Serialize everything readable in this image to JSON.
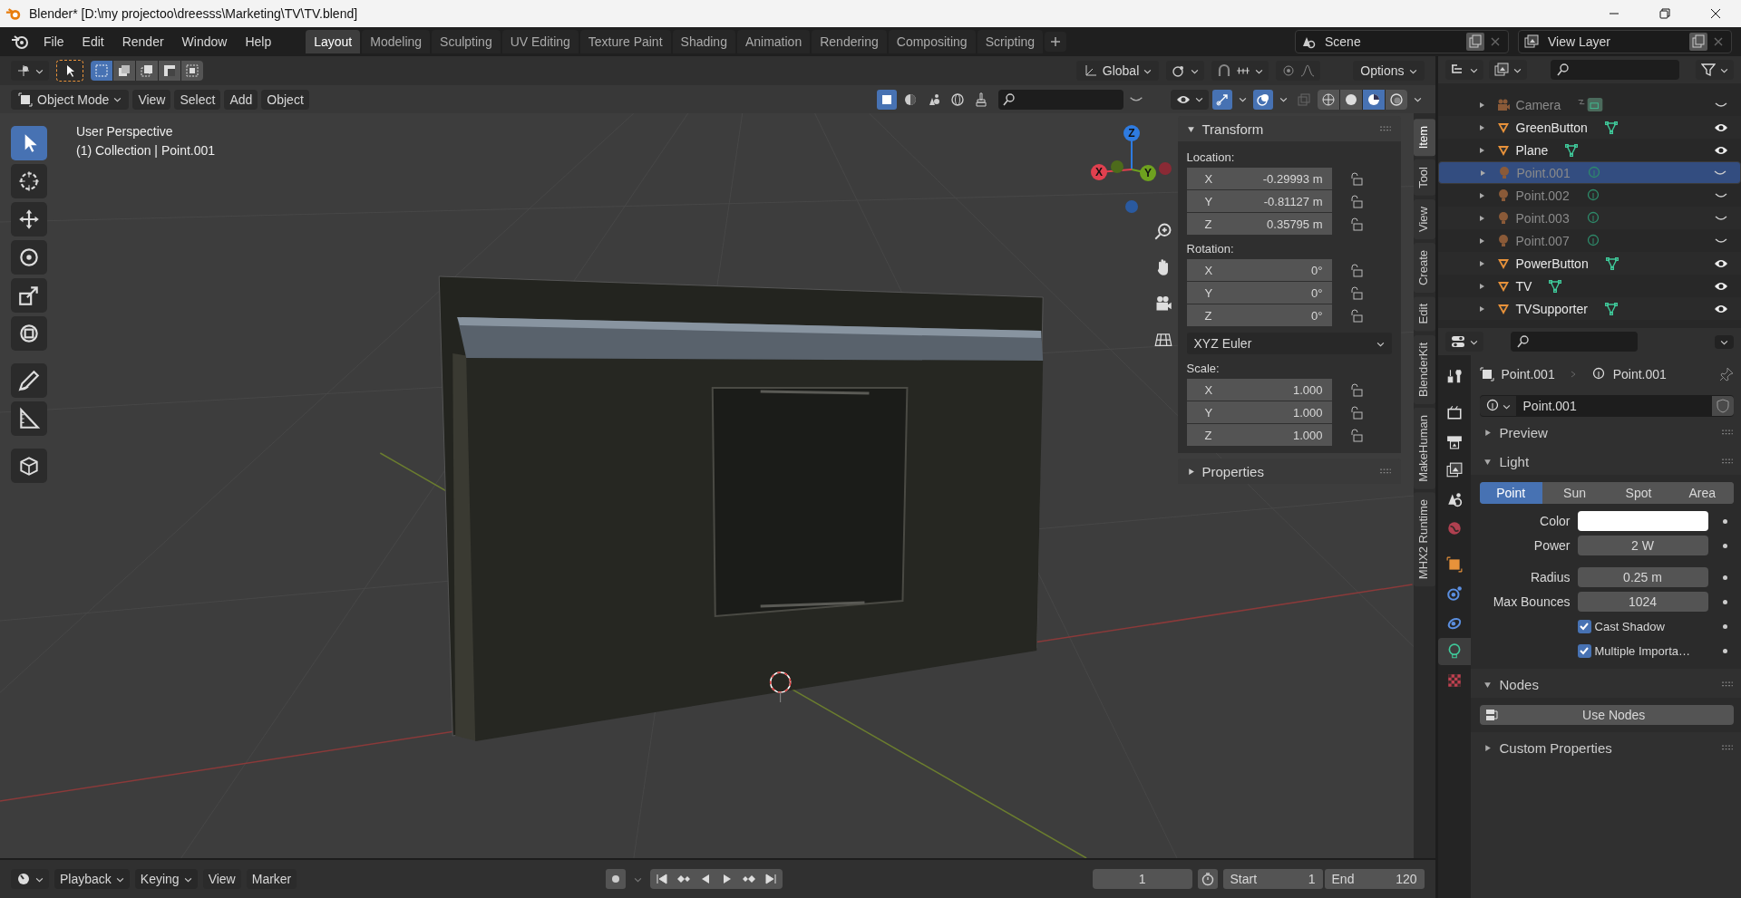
{
  "window": {
    "title": "Blender* [D:\\my projectoo\\dreesss\\Marketing\\TV\\TV.blend]"
  },
  "menu": [
    "File",
    "Edit",
    "Render",
    "Window",
    "Help"
  ],
  "workspaces": [
    {
      "label": "Layout",
      "selected": true
    },
    {
      "label": "Modeling",
      "selected": false
    },
    {
      "label": "Sculpting",
      "selected": false
    },
    {
      "label": "UV Editing",
      "selected": false
    },
    {
      "label": "Texture Paint",
      "selected": false
    },
    {
      "label": "Shading",
      "selected": false
    },
    {
      "label": "Animation",
      "selected": false
    },
    {
      "label": "Rendering",
      "selected": false
    },
    {
      "label": "Compositing",
      "selected": false
    },
    {
      "label": "Scripting",
      "selected": false
    }
  ],
  "scene": "Scene",
  "view_layer": "View Layer",
  "viewport": {
    "orientation": "Global",
    "options": "Options",
    "mode": "Object Mode",
    "menus": [
      "View",
      "Select",
      "Add",
      "Object"
    ],
    "info": [
      "User Perspective",
      "(1) Collection | Point.001"
    ],
    "gizmo": [
      {
        "label": "X",
        "color": "#e0404f"
      },
      {
        "label": "Y",
        "color": "#6ea11f"
      },
      {
        "label": "Z",
        "color": "#2e7be0"
      }
    ],
    "tools": [
      {
        "kind": "select",
        "selected": true
      },
      {
        "kind": "cursor",
        "selected": false
      },
      {
        "kind": "move",
        "selected": false
      },
      {
        "kind": "rotate",
        "selected": false
      },
      {
        "kind": "scale",
        "selected": false
      },
      {
        "kind": "transform",
        "selected": false
      },
      {
        "kind": "annotate",
        "selected": false
      },
      {
        "kind": "measure",
        "selected": false
      },
      {
        "kind": "add_cube",
        "selected": false
      }
    ]
  },
  "sidebar": {
    "tabs": [
      {
        "label": "Item",
        "selected": true
      },
      {
        "label": "Tool",
        "selected": false
      },
      {
        "label": "View",
        "selected": false
      },
      {
        "label": "Create",
        "selected": false
      },
      {
        "label": "Edit",
        "selected": false
      },
      {
        "label": "BlenderKit",
        "selected": false
      },
      {
        "label": "MakeHuman",
        "selected": false
      },
      {
        "label": "MHX2 Runtime",
        "selected": false
      }
    ],
    "transform_title": "Transform",
    "location": {
      "label": "Location:",
      "fields": [
        {
          "axis": "X",
          "value": "-0.29993 m"
        },
        {
          "axis": "Y",
          "value": "-0.81127 m"
        },
        {
          "axis": "Z",
          "value": "0.35795 m"
        }
      ]
    },
    "rotation": {
      "label": "Rotation:",
      "fields": [
        {
          "axis": "X",
          "value": "0°"
        },
        {
          "axis": "Y",
          "value": "0°"
        },
        {
          "axis": "Z",
          "value": "0°"
        }
      ]
    },
    "rotation_mode": "XYZ Euler",
    "scale": {
      "label": "Scale:",
      "fields": [
        {
          "axis": "X",
          "value": "1.000"
        },
        {
          "axis": "Y",
          "value": "1.000"
        },
        {
          "axis": "Z",
          "value": "1.000"
        }
      ]
    },
    "properties_title": "Properties"
  },
  "outliner": {
    "rows": [
      {
        "name": "Camera",
        "kind": "camera",
        "visible": false,
        "selected": false
      },
      {
        "name": "GreenButton",
        "kind": "mesh",
        "visible": true,
        "selected": false
      },
      {
        "name": "Plane",
        "kind": "mesh",
        "visible": true,
        "selected": false
      },
      {
        "name": "Point.001",
        "kind": "light",
        "visible": false,
        "selected": true
      },
      {
        "name": "Point.002",
        "kind": "light",
        "visible": false,
        "selected": false
      },
      {
        "name": "Point.003",
        "kind": "light",
        "visible": false,
        "selected": false
      },
      {
        "name": "Point.007",
        "kind": "light",
        "visible": false,
        "selected": false
      },
      {
        "name": "PowerButton",
        "kind": "mesh",
        "visible": true,
        "selected": false
      },
      {
        "name": "TV",
        "kind": "mesh",
        "visible": true,
        "selected": false
      },
      {
        "name": "TVSupporter",
        "kind": "mesh",
        "visible": true,
        "selected": false
      }
    ]
  },
  "properties": {
    "tabs": [
      {
        "kind": "tool",
        "selected": false
      },
      {
        "kind": "render",
        "selected": false
      },
      {
        "kind": "output",
        "selected": false
      },
      {
        "kind": "view_layer",
        "selected": false
      },
      {
        "kind": "scene",
        "selected": false
      },
      {
        "kind": "world",
        "selected": false
      },
      {
        "kind": "object",
        "selected": false
      },
      {
        "kind": "physics",
        "selected": false
      },
      {
        "kind": "constraints",
        "selected": false
      },
      {
        "kind": "light_data",
        "selected": true
      },
      {
        "kind": "texture",
        "selected": false
      }
    ],
    "breadcrumb": [
      "Point.001",
      "Point.001"
    ],
    "datablock": "Point.001",
    "panels": [
      {
        "kind": "preview",
        "title": "Preview",
        "expanded": false
      },
      {
        "kind": "light",
        "title": "Light",
        "expanded": true
      },
      {
        "kind": "nodes",
        "title": "Nodes",
        "expanded": true
      },
      {
        "kind": "custom",
        "title": "Custom Properties",
        "expanded": false
      }
    ],
    "light_types": [
      {
        "label": "Point",
        "selected": true
      },
      {
        "label": "Sun",
        "selected": false
      },
      {
        "label": "Spot",
        "selected": false
      },
      {
        "label": "Area",
        "selected": false
      }
    ],
    "fields": [
      {
        "kind": "color",
        "label": "Color",
        "color": "#ffffff"
      },
      {
        "kind": "number",
        "label": "Power",
        "value": "2 W"
      },
      {
        "kind": "number",
        "label": "Radius",
        "value": "0.25 m"
      },
      {
        "kind": "number",
        "label": "Max Bounces",
        "value": "1024"
      }
    ],
    "checkboxes": [
      {
        "label": "Cast Shadow",
        "checked": true
      },
      {
        "label": "Multiple Importa…",
        "checked": true
      }
    ],
    "use_nodes": "Use Nodes"
  },
  "timeline": {
    "menus": [
      "Playback",
      "Keying",
      "View",
      "Marker"
    ],
    "frame": "1",
    "start_label": "Start",
    "start": "1",
    "end_label": "End",
    "end": "120"
  }
}
